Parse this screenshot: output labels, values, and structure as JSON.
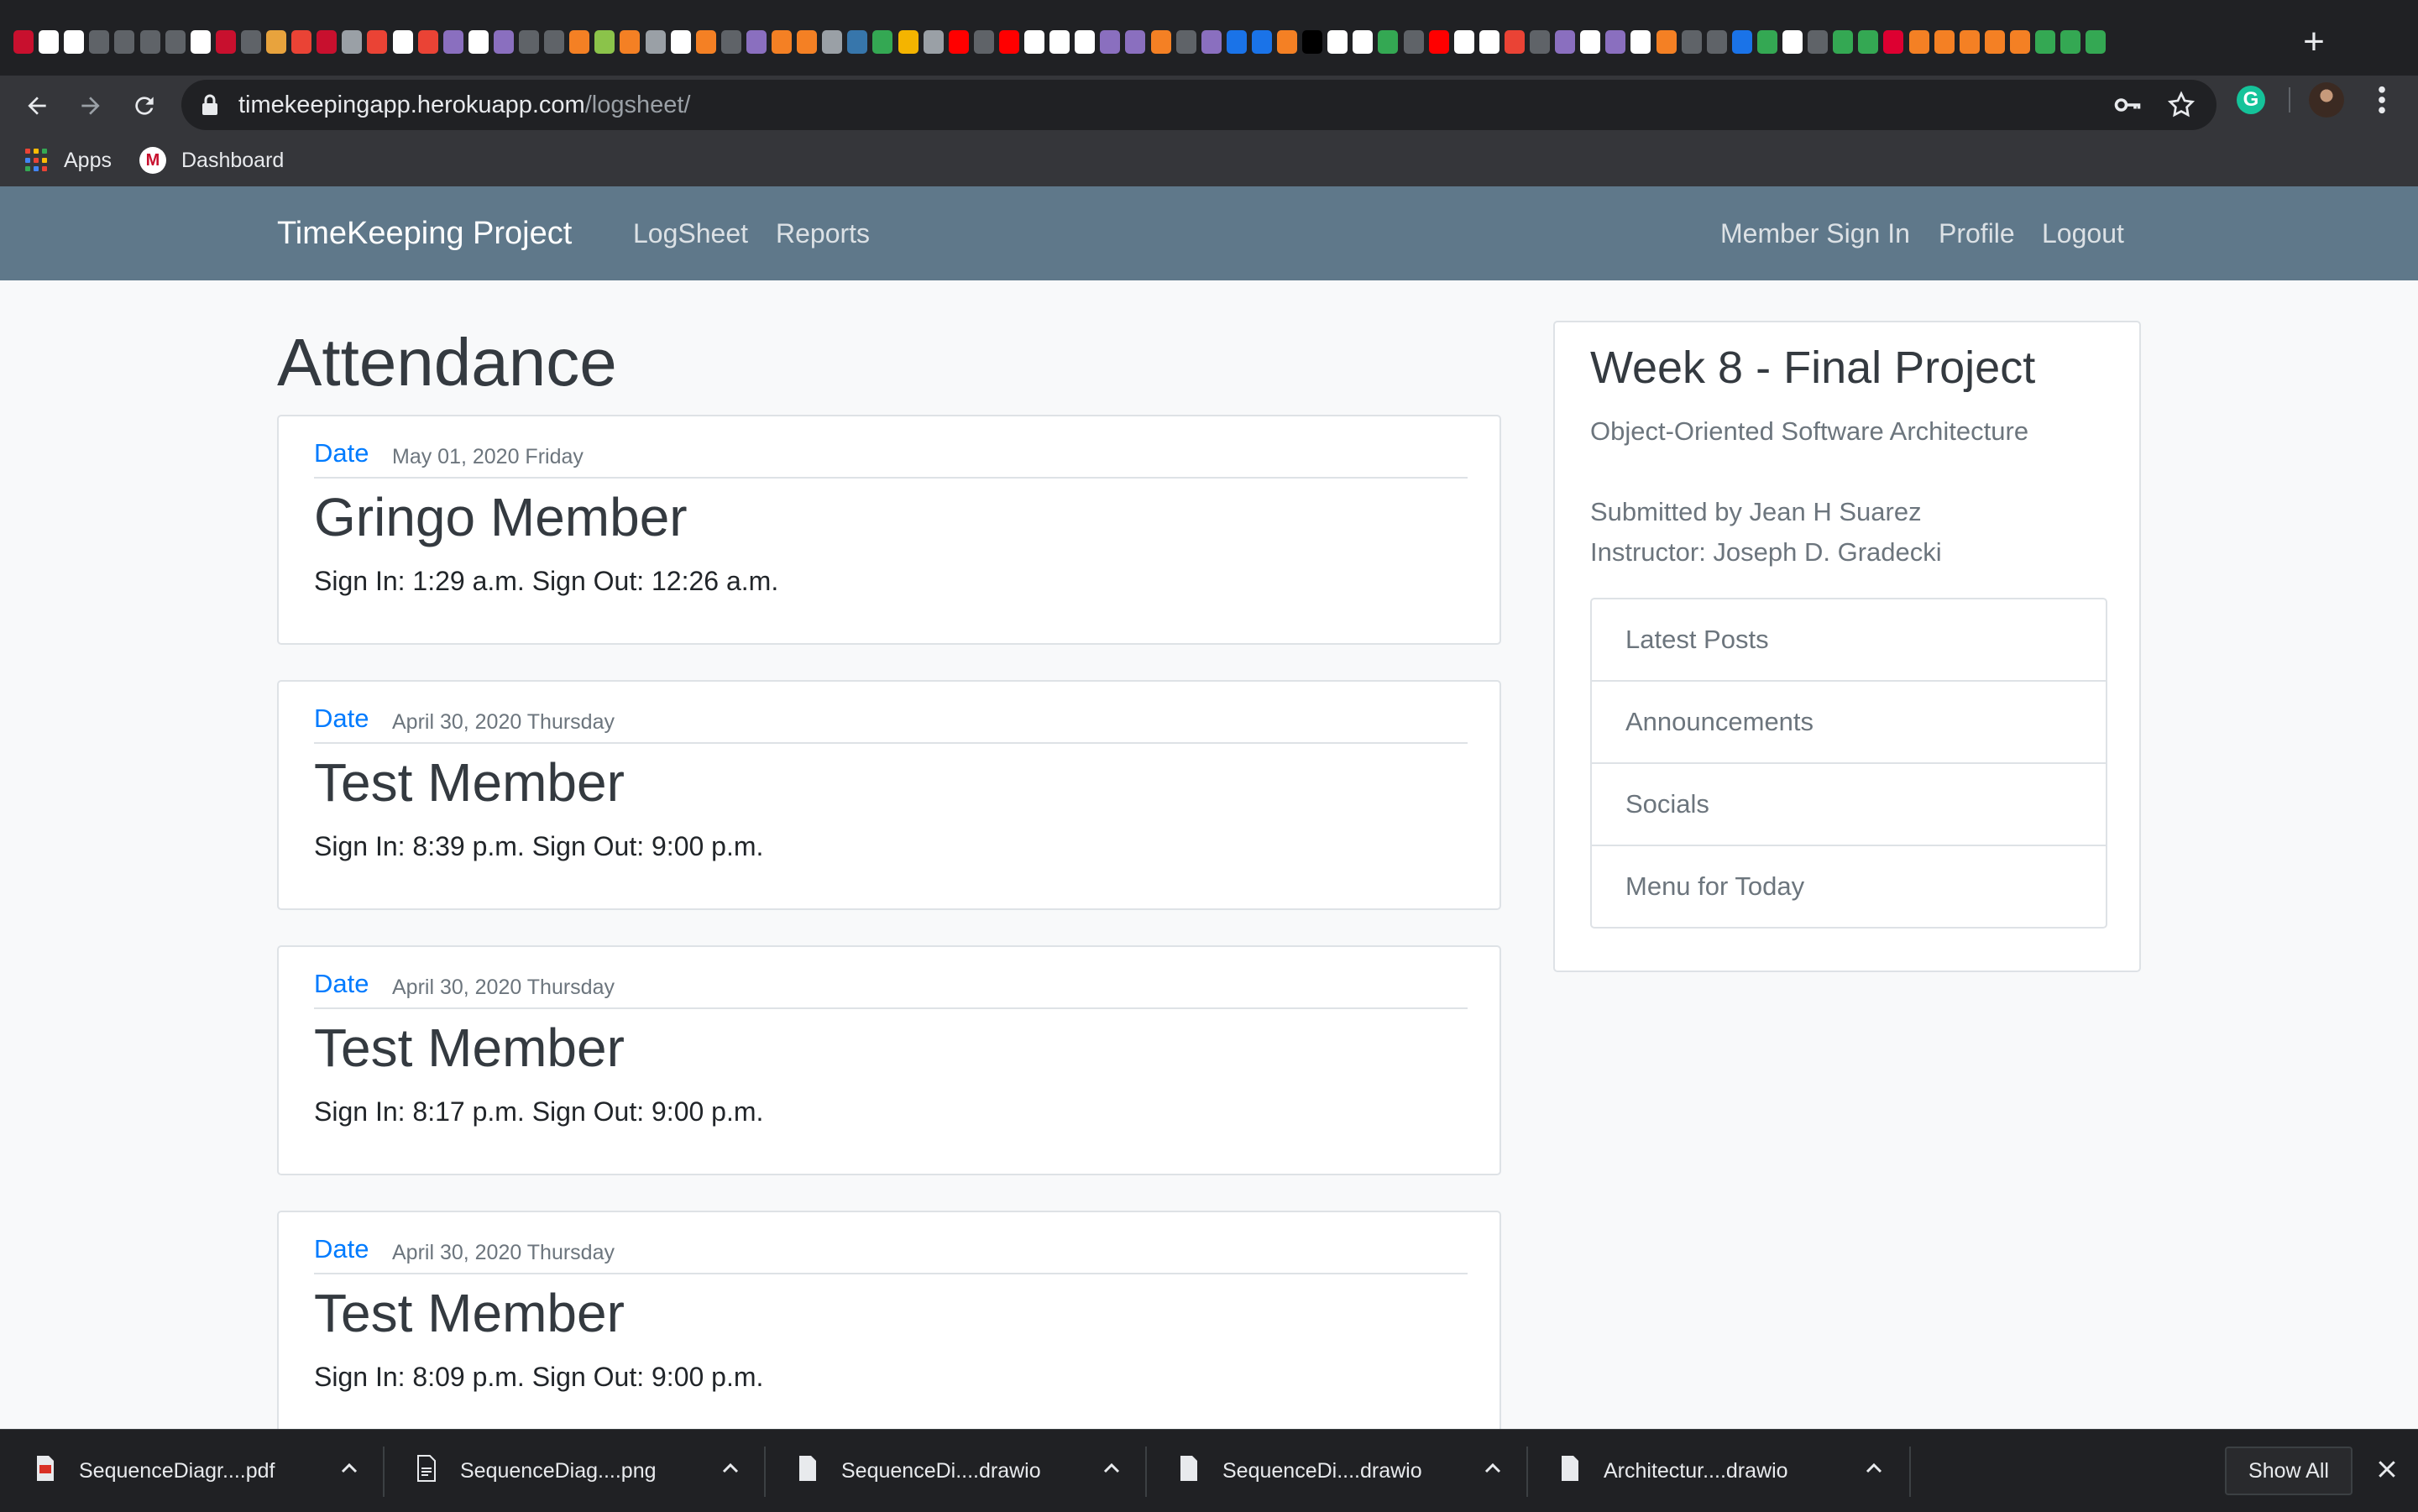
{
  "browser": {
    "url_host": "timekeepingapp.herokuapp.com",
    "url_path": "/logsheet/",
    "new_tab_label": "+",
    "tab_favicons": [
      {
        "icon": "swarthmore-icon",
        "color": "#c8102e"
      },
      {
        "icon": "github-icon",
        "color": "#ffffff"
      },
      {
        "icon": "github-icon",
        "color": "#ffffff"
      },
      {
        "icon": "codepen-icon",
        "color": "#5f6368"
      },
      {
        "icon": "codepen-icon",
        "color": "#5f6368"
      },
      {
        "icon": "codepen-icon",
        "color": "#5f6368"
      },
      {
        "icon": "codepen-icon",
        "color": "#5f6368"
      },
      {
        "icon": "github-icon",
        "color": "#ffffff"
      },
      {
        "icon": "swarthmore-icon",
        "color": "#c8102e"
      },
      {
        "icon": "codepen-icon",
        "color": "#5f6368"
      },
      {
        "icon": "slack-icon",
        "color": "#e8a33d"
      },
      {
        "icon": "gmail-icon",
        "color": "#ea4335"
      },
      {
        "icon": "swarthmore-icon",
        "color": "#c8102e"
      },
      {
        "icon": "android-icon",
        "color": "#9aa0a6"
      },
      {
        "icon": "gmail-icon",
        "color": "#ea4335"
      },
      {
        "icon": "istock-icon",
        "color": "#ffffff"
      },
      {
        "icon": "gmail-icon",
        "color": "#ea4335"
      },
      {
        "icon": "heroku-icon",
        "color": "#8a6fbf"
      },
      {
        "icon": "github-icon",
        "color": "#ffffff"
      },
      {
        "icon": "heroku-icon",
        "color": "#8a6fbf"
      },
      {
        "icon": "codepen-icon",
        "color": "#5f6368"
      },
      {
        "icon": "codepen-icon",
        "color": "#5f6368"
      },
      {
        "icon": "stackoverflow-icon",
        "color": "#f48024"
      },
      {
        "icon": "bulb-icon",
        "color": "#8bc34a"
      },
      {
        "icon": "bookmark-icon",
        "color": "#f48024"
      },
      {
        "icon": "docs-icon",
        "color": "#9aa0a6"
      },
      {
        "icon": "codepen-icon",
        "color": "#ffffff"
      },
      {
        "icon": "stackoverflow-icon",
        "color": "#f48024"
      },
      {
        "icon": "codepen-icon",
        "color": "#5f6368"
      },
      {
        "icon": "heroku-icon",
        "color": "#8a6fbf"
      },
      {
        "icon": "stackoverflow-icon",
        "color": "#f48024"
      },
      {
        "icon": "stackoverflow-icon",
        "color": "#f48024"
      },
      {
        "icon": "docs-icon",
        "color": "#9aa0a6"
      },
      {
        "icon": "python-icon",
        "color": "#3776ab"
      },
      {
        "icon": "chrome-icon",
        "color": "#34a853"
      },
      {
        "icon": "lightning-icon",
        "color": "#f4b400"
      },
      {
        "icon": "docs-icon",
        "color": "#9aa0a6"
      },
      {
        "icon": "youtube-icon",
        "color": "#ff0000"
      },
      {
        "icon": "codepen-icon",
        "color": "#5f6368"
      },
      {
        "icon": "youtube-icon",
        "color": "#ff0000"
      },
      {
        "icon": "github-icon",
        "color": "#ffffff"
      },
      {
        "icon": "django-icon",
        "color": "#ffffff"
      },
      {
        "icon": "github-icon",
        "color": "#ffffff"
      },
      {
        "icon": "heroku-icon",
        "color": "#8a6fbf"
      },
      {
        "icon": "heroku-icon",
        "color": "#8a6fbf"
      },
      {
        "icon": "stackoverflow-icon",
        "color": "#f48024"
      },
      {
        "icon": "codepen-icon",
        "color": "#5f6368"
      },
      {
        "icon": "heroku-icon",
        "color": "#8a6fbf"
      },
      {
        "icon": "refresh-icon",
        "color": "#1a73e8"
      },
      {
        "icon": "bracket-icon",
        "color": "#1a73e8"
      },
      {
        "icon": "stackoverflow-icon",
        "color": "#f48024"
      },
      {
        "icon": "dark-icon",
        "color": "#000000"
      },
      {
        "icon": "github-icon",
        "color": "#ffffff"
      },
      {
        "icon": "github-icon",
        "color": "#ffffff"
      },
      {
        "icon": "drive-icon",
        "color": "#34a853"
      },
      {
        "icon": "codepen-icon",
        "color": "#5f6368"
      },
      {
        "icon": "youtube-icon",
        "color": "#ff0000"
      },
      {
        "icon": "github-icon",
        "color": "#ffffff"
      },
      {
        "icon": "codepen-icon",
        "color": "#ffffff"
      },
      {
        "icon": "chrome-icon",
        "color": "#ea4335"
      },
      {
        "icon": "codepen-icon",
        "color": "#5f6368"
      },
      {
        "icon": "heroku-icon",
        "color": "#8a6fbf"
      },
      {
        "icon": "github-icon",
        "color": "#ffffff"
      },
      {
        "icon": "heroku-icon",
        "color": "#8a6fbf"
      },
      {
        "icon": "django-icon",
        "color": "#ffffff"
      },
      {
        "icon": "stackoverflow-icon",
        "color": "#f48024"
      },
      {
        "icon": "codepen-icon",
        "color": "#5f6368"
      },
      {
        "icon": "codepen-icon",
        "color": "#5f6368"
      },
      {
        "icon": "gitlab-icon",
        "color": "#1a73e8"
      },
      {
        "icon": "chrome-icon",
        "color": "#34a853"
      },
      {
        "icon": "github-icon",
        "color": "#ffffff"
      },
      {
        "icon": "codepen-icon",
        "color": "#5f6368"
      },
      {
        "icon": "chrome-icon",
        "color": "#34a853"
      },
      {
        "icon": "chrome-icon",
        "color": "#34a853"
      },
      {
        "icon": "angular-icon",
        "color": "#dd0031"
      },
      {
        "icon": "stackoverflow-icon",
        "color": "#f48024"
      },
      {
        "icon": "stackoverflow-icon",
        "color": "#f48024"
      },
      {
        "icon": "stackoverflow-icon",
        "color": "#f48024"
      },
      {
        "icon": "stackoverflow-icon",
        "color": "#f48024"
      },
      {
        "icon": "stackoverflow-icon",
        "color": "#f48024"
      },
      {
        "icon": "chrome-icon",
        "color": "#34a853"
      },
      {
        "icon": "chrome-icon",
        "color": "#34a853"
      },
      {
        "icon": "chrome-icon",
        "color": "#34a853"
      }
    ]
  },
  "bookmarks": {
    "apps_label": "Apps",
    "dashboard_label": "Dashboard"
  },
  "nav": {
    "brand": "TimeKeeping Project",
    "left_links": [
      "LogSheet",
      "Reports"
    ],
    "right_links": [
      "Member Sign In",
      "Profile",
      "Logout"
    ]
  },
  "main": {
    "title": "Attendance",
    "entries": [
      {
        "date_label": "Date",
        "date": "May 01, 2020 Friday",
        "member": "Gringo Member",
        "times": "Sign In: 1:29 a.m. Sign Out: 12:26 a.m."
      },
      {
        "date_label": "Date",
        "date": "April 30, 2020 Thursday",
        "member": "Test Member",
        "times": "Sign In: 8:39 p.m. Sign Out: 9:00 p.m."
      },
      {
        "date_label": "Date",
        "date": "April 30, 2020 Thursday",
        "member": "Test Member",
        "times": "Sign In: 8:17 p.m. Sign Out: 9:00 p.m."
      },
      {
        "date_label": "Date",
        "date": "April 30, 2020 Thursday",
        "member": "Test Member",
        "times": "Sign In: 8:09 p.m. Sign Out: 9:00 p.m."
      }
    ]
  },
  "sidebar": {
    "title": "Week 8 - Final Project",
    "subtitle": "Object-Oriented Software Architecture",
    "submitted_by": "Submitted by Jean H Suarez",
    "instructor": "Instructor: Joseph D. Gradecki",
    "links": [
      "Latest Posts",
      "Announcements",
      "Socials",
      "Menu for Today"
    ]
  },
  "downloads": {
    "items": [
      {
        "name": "SequenceDiagr....pdf",
        "icon": "pdf-file-icon"
      },
      {
        "name": "SequenceDiag....png",
        "icon": "image-file-icon"
      },
      {
        "name": "SequenceDi....drawio",
        "icon": "file-icon"
      },
      {
        "name": "SequenceDi....drawio",
        "icon": "file-icon"
      },
      {
        "name": "Architectur....drawio",
        "icon": "file-icon"
      }
    ],
    "show_all_label": "Show All"
  },
  "colors": {
    "navbar_bg": "#5f788a",
    "link_blue": "#007bff",
    "page_bg": "#f8f9fa"
  }
}
